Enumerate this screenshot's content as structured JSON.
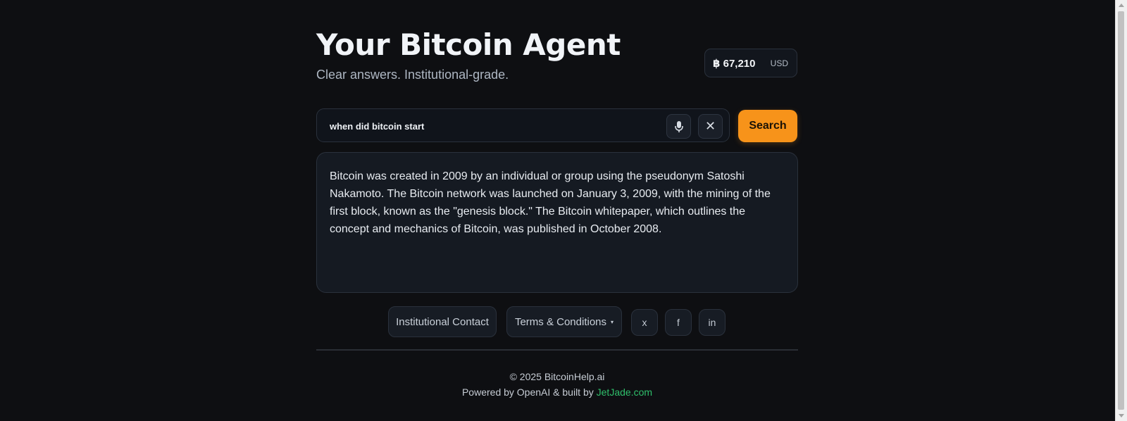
{
  "header": {
    "title": "Your Bitcoin Agent",
    "subtitle": "Clear answers. Institutional-grade."
  },
  "price": {
    "value": "฿ 67,210",
    "currency": "USD"
  },
  "search": {
    "query": "when did bitcoin start",
    "button_label": "Search",
    "mic_icon": "microphone-icon",
    "clear_icon": "close-icon",
    "clear_glyph": "✕"
  },
  "answer": {
    "text": "Bitcoin was created in 2009 by an individual or group using the pseudonym Satoshi Nakamoto. The Bitcoin network was launched on January 3, 2009, with the mining of the first block, known as the \"genesis block.\" The Bitcoin whitepaper, which outlines the concept and mechanics of Bitcoin, was published in October 2008."
  },
  "footer": {
    "contact_label": "Institutional Contact",
    "terms_label": "Terms & Conditions",
    "terms_caret": "▾",
    "social": {
      "x": "x",
      "facebook": "f",
      "linkedin": "in"
    },
    "copyright": "© 2025 BitcoinHelp.ai",
    "powered_prefix": "Powered by OpenAI & built by ",
    "powered_link": "JetJade.com"
  },
  "colors": {
    "background": "#0e0f12",
    "accent": "#f7931a",
    "link": "#2fbf6b"
  }
}
